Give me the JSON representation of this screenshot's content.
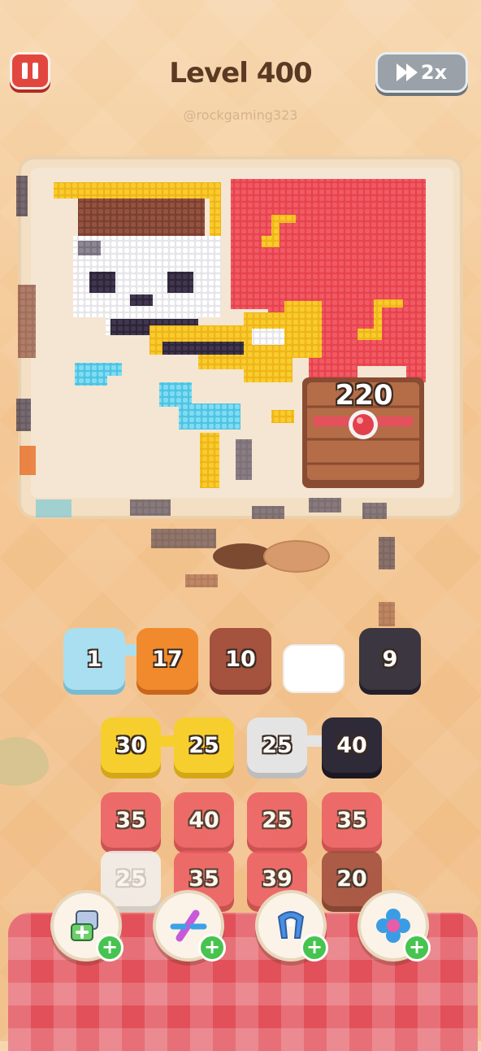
{
  "header": {
    "level_title": "Level 400",
    "username": "@rockgaming323",
    "speed_label": "2x"
  },
  "board": {
    "chest_count": "220"
  },
  "tray": [
    {
      "value": "1",
      "color": "#a9dff0"
    },
    {
      "value": "17",
      "color": "#f08a2c"
    },
    {
      "value": "10",
      "color": "#a5523f"
    },
    {
      "value": "",
      "color": "#ffffff"
    },
    {
      "value": "9",
      "color": "#3b3640"
    }
  ],
  "grid": {
    "rows": [
      [
        {
          "value": "30",
          "color": "#f6cf2e"
        },
        {
          "value": "25",
          "color": "#f6cf2e"
        },
        {
          "value": "25",
          "color": "#e4e4e4"
        },
        {
          "value": "40",
          "color": "#2e2a38"
        }
      ],
      [
        {
          "value": "35",
          "color": "#ec5c63"
        },
        {
          "value": "40",
          "color": "#ec5c63"
        },
        {
          "value": "25",
          "color": "#ec5c63"
        },
        {
          "value": "35",
          "color": "#ec5c63"
        }
      ],
      [
        {
          "value": "25",
          "color": "#f2f2f2"
        },
        {
          "value": "35",
          "color": "#ec5c63"
        },
        {
          "value": "39",
          "color": "#ec5c63"
        },
        {
          "value": "20",
          "color": "#a4503e"
        }
      ]
    ]
  },
  "boosters": [
    {
      "name": "add-slot-icon"
    },
    {
      "name": "magic-wand-icon"
    },
    {
      "name": "magnet-icon"
    },
    {
      "name": "flower-icon"
    }
  ],
  "colors": {
    "pause": "#e2473f",
    "pixel_red": "#e7434e",
    "pixel_yellow": "#f6c21f",
    "pixel_white": "#ffffff",
    "pixel_brown": "#8b4a38",
    "pixel_dark": "#3a2f45",
    "pixel_blue": "#6fd4ee",
    "tablecloth": "#e2505a"
  }
}
